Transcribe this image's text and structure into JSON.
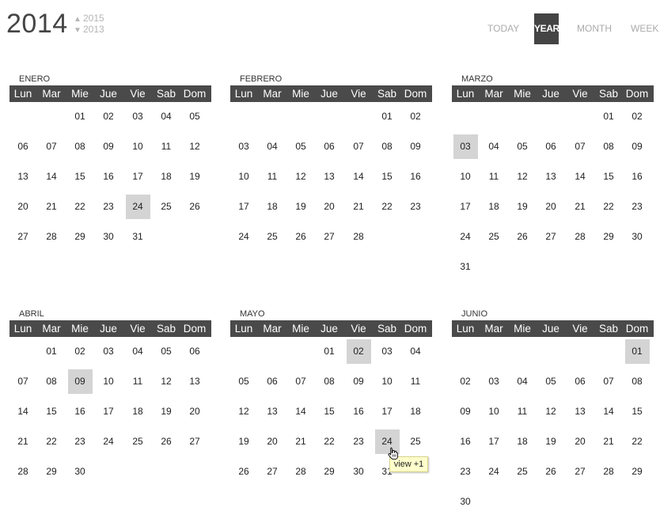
{
  "header": {
    "year": "2014",
    "next_year": "2015",
    "prev_year": "2013",
    "up_arrow": "▲",
    "down_arrow": "▼"
  },
  "view_tabs": {
    "today": "TODAY",
    "year": "YEAR",
    "month": "MONTH",
    "week": "WEEK",
    "active": "year"
  },
  "weekdays": [
    "Lun",
    "Mar",
    "Mie",
    "Jue",
    "Vie",
    "Sab",
    "Dom"
  ],
  "months": [
    {
      "name": "ENERO",
      "offset": 2,
      "days": 31,
      "highlighted": [
        24
      ]
    },
    {
      "name": "FEBRERO",
      "offset": 5,
      "days": 28,
      "highlighted": []
    },
    {
      "name": "MARZO",
      "offset": 5,
      "days": 31,
      "highlighted": [
        3
      ]
    },
    {
      "name": "ABRIL",
      "offset": 1,
      "days": 30,
      "highlighted": [
        9
      ]
    },
    {
      "name": "MAYO",
      "offset": 3,
      "days": 31,
      "highlighted": [
        2,
        24
      ]
    },
    {
      "name": "JUNIO",
      "offset": 6,
      "days": 30,
      "highlighted": [
        1
      ]
    }
  ],
  "tooltip": {
    "text": "view +1"
  },
  "colors": {
    "header_bar": "#4a4a4a",
    "highlight": "#d4d4d4",
    "active_tab": "#444444",
    "tooltip_bg": "#ffffcc"
  }
}
